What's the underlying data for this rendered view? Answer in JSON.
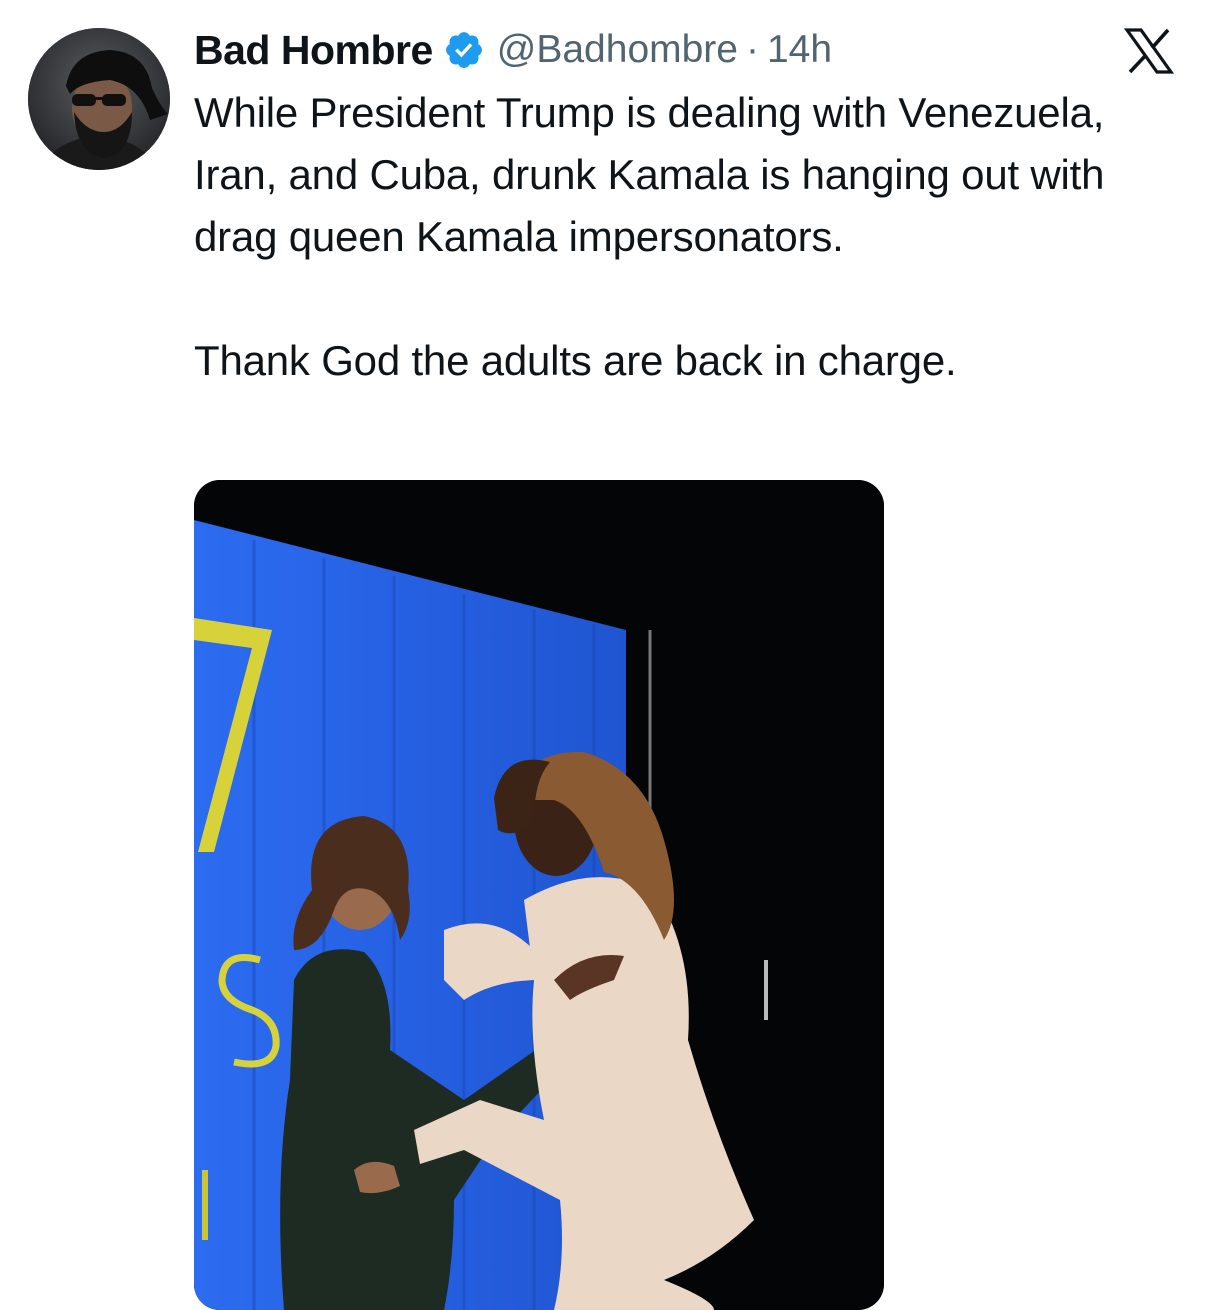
{
  "tweet": {
    "author": {
      "display_name": "Bad Hombre",
      "handle": "@Badhombre",
      "verified": true,
      "avatar_icon": "profile-photo"
    },
    "separator": "·",
    "timestamp": "14h",
    "text_lines_1": "While President Trump is dealing with Venezuela, Iran, and Cuba, drunk Kamala is hanging out with drag queen Kamala impersonators.",
    "text_lines_2": "Thank God the adults are back in charge.",
    "media": {
      "type": "video-still",
      "backdrop_color": "#2a62e0",
      "backdrop_letters": [
        "7",
        "S",
        "I"
      ]
    }
  },
  "platform": {
    "logo_icon": "x-logo-icon"
  },
  "colors": {
    "text_primary": "#0f1419",
    "text_secondary": "#536471",
    "verified_badge": "#1d9bf0"
  }
}
